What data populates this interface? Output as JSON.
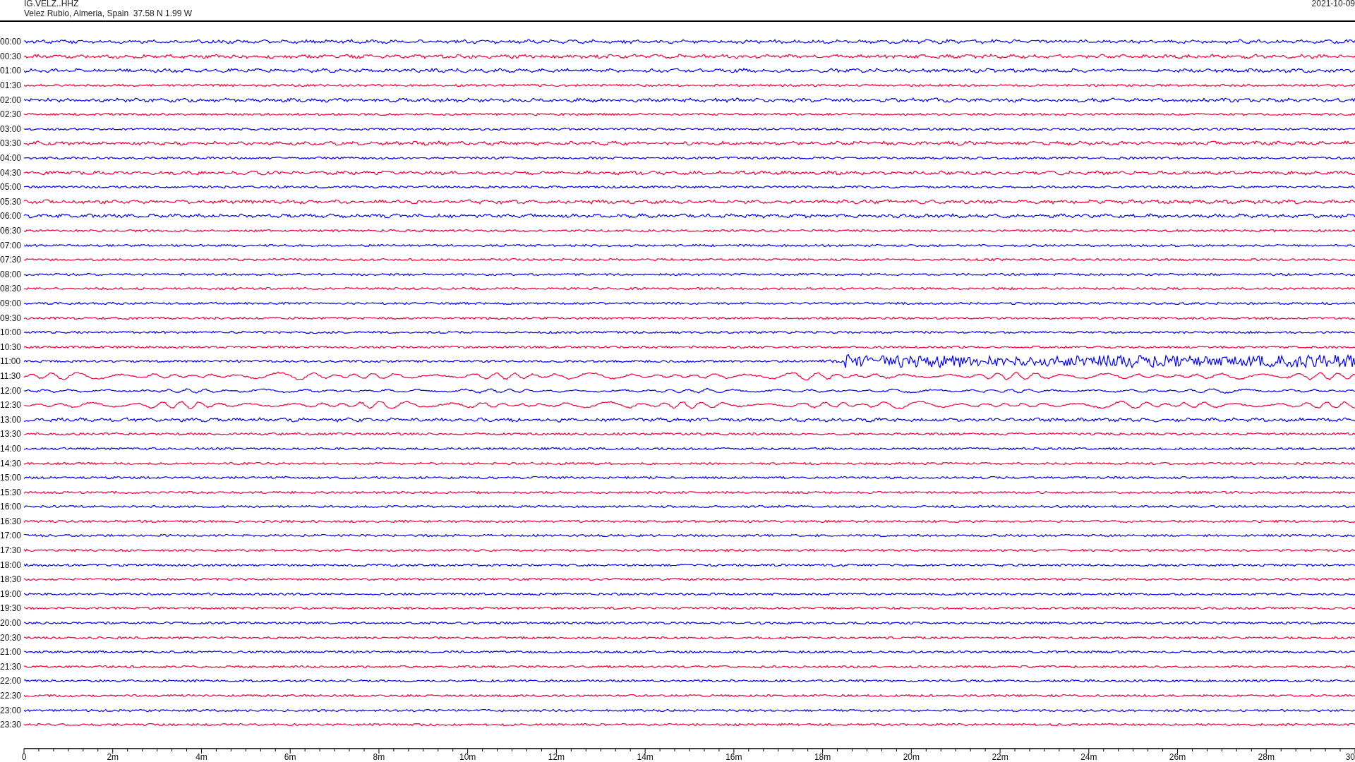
{
  "header": {
    "station_code": "IG.VELZ..HHZ",
    "location": "Velez Rubio, Almeria, Spain  37.58 N 1.99 W",
    "date": "2021-10-09"
  },
  "rows": [
    {
      "time": "00:00",
      "color": "#0000ff",
      "kind": "noisy"
    },
    {
      "time": "00:30",
      "color": "#ff0033",
      "kind": "noisy"
    },
    {
      "time": "01:00",
      "color": "#0000ff",
      "kind": "noisy"
    },
    {
      "time": "01:30",
      "color": "#ff0033",
      "kind": "quiet"
    },
    {
      "time": "02:00",
      "color": "#0000ff",
      "kind": "noisy"
    },
    {
      "time": "02:30",
      "color": "#ff0033",
      "kind": "quiet"
    },
    {
      "time": "03:00",
      "color": "#0000ff",
      "kind": "quiet"
    },
    {
      "time": "03:30",
      "color": "#ff0033",
      "kind": "noisy"
    },
    {
      "time": "04:00",
      "color": "#0000ff",
      "kind": "quiet"
    },
    {
      "time": "04:30",
      "color": "#ff0033",
      "kind": "noisy"
    },
    {
      "time": "05:00",
      "color": "#0000ff",
      "kind": "quiet"
    },
    {
      "time": "05:30",
      "color": "#ff0033",
      "kind": "noisy"
    },
    {
      "time": "06:00",
      "color": "#0000ff",
      "kind": "noisy"
    },
    {
      "time": "06:30",
      "color": "#ff0033",
      "kind": "quiet"
    },
    {
      "time": "07:00",
      "color": "#0000ff",
      "kind": "quiet"
    },
    {
      "time": "07:30",
      "color": "#ff0033",
      "kind": "quiet"
    },
    {
      "time": "08:00",
      "color": "#0000ff",
      "kind": "quiet"
    },
    {
      "time": "08:30",
      "color": "#ff0033",
      "kind": "quiet"
    },
    {
      "time": "09:00",
      "color": "#0000ff",
      "kind": "quiet"
    },
    {
      "time": "09:30",
      "color": "#ff0033",
      "kind": "quiet"
    },
    {
      "time": "10:00",
      "color": "#0000ff",
      "kind": "quiet"
    },
    {
      "time": "10:30",
      "color": "#ff0033",
      "kind": "quiet"
    },
    {
      "time": "11:00",
      "color": "#0000ff",
      "kind": "event"
    },
    {
      "time": "11:30",
      "color": "#ff0033",
      "kind": "swell"
    },
    {
      "time": "12:00",
      "color": "#0000ff",
      "kind": "swell"
    },
    {
      "time": "12:30",
      "color": "#ff0033",
      "kind": "swell"
    },
    {
      "time": "13:00",
      "color": "#0000ff",
      "kind": "noisy"
    },
    {
      "time": "13:30",
      "color": "#ff0033",
      "kind": "quiet"
    },
    {
      "time": "14:00",
      "color": "#0000ff",
      "kind": "quiet"
    },
    {
      "time": "14:30",
      "color": "#ff0033",
      "kind": "quiet"
    },
    {
      "time": "15:00",
      "color": "#0000ff",
      "kind": "quiet"
    },
    {
      "time": "15:30",
      "color": "#ff0033",
      "kind": "quiet"
    },
    {
      "time": "16:00",
      "color": "#0000ff",
      "kind": "quiet"
    },
    {
      "time": "16:30",
      "color": "#ff0033",
      "kind": "quiet"
    },
    {
      "time": "17:00",
      "color": "#0000ff",
      "kind": "quiet"
    },
    {
      "time": "17:30",
      "color": "#ff0033",
      "kind": "quiet"
    },
    {
      "time": "18:00",
      "color": "#0000ff",
      "kind": "quiet"
    },
    {
      "time": "18:30",
      "color": "#ff0033",
      "kind": "quiet"
    },
    {
      "time": "19:00",
      "color": "#0000ff",
      "kind": "quiet"
    },
    {
      "time": "19:30",
      "color": "#ff0033",
      "kind": "quiet"
    },
    {
      "time": "20:00",
      "color": "#0000ff",
      "kind": "quiet"
    },
    {
      "time": "20:30",
      "color": "#ff0033",
      "kind": "quiet"
    },
    {
      "time": "21:00",
      "color": "#0000ff",
      "kind": "quiet"
    },
    {
      "time": "21:30",
      "color": "#ff0033",
      "kind": "quiet"
    },
    {
      "time": "22:00",
      "color": "#0000ff",
      "kind": "quiet"
    },
    {
      "time": "22:30",
      "color": "#ff0033",
      "kind": "quiet"
    },
    {
      "time": "23:00",
      "color": "#0000ff",
      "kind": "quiet"
    },
    {
      "time": "23:30",
      "color": "#ff0033",
      "kind": "quiet"
    }
  ],
  "axis": {
    "labels": [
      "0",
      "2m",
      "4m",
      "6m",
      "8m",
      "10m",
      "12m",
      "14m",
      "16m",
      "18m",
      "20m",
      "22m",
      "24m",
      "26m",
      "28m",
      "30"
    ]
  }
}
